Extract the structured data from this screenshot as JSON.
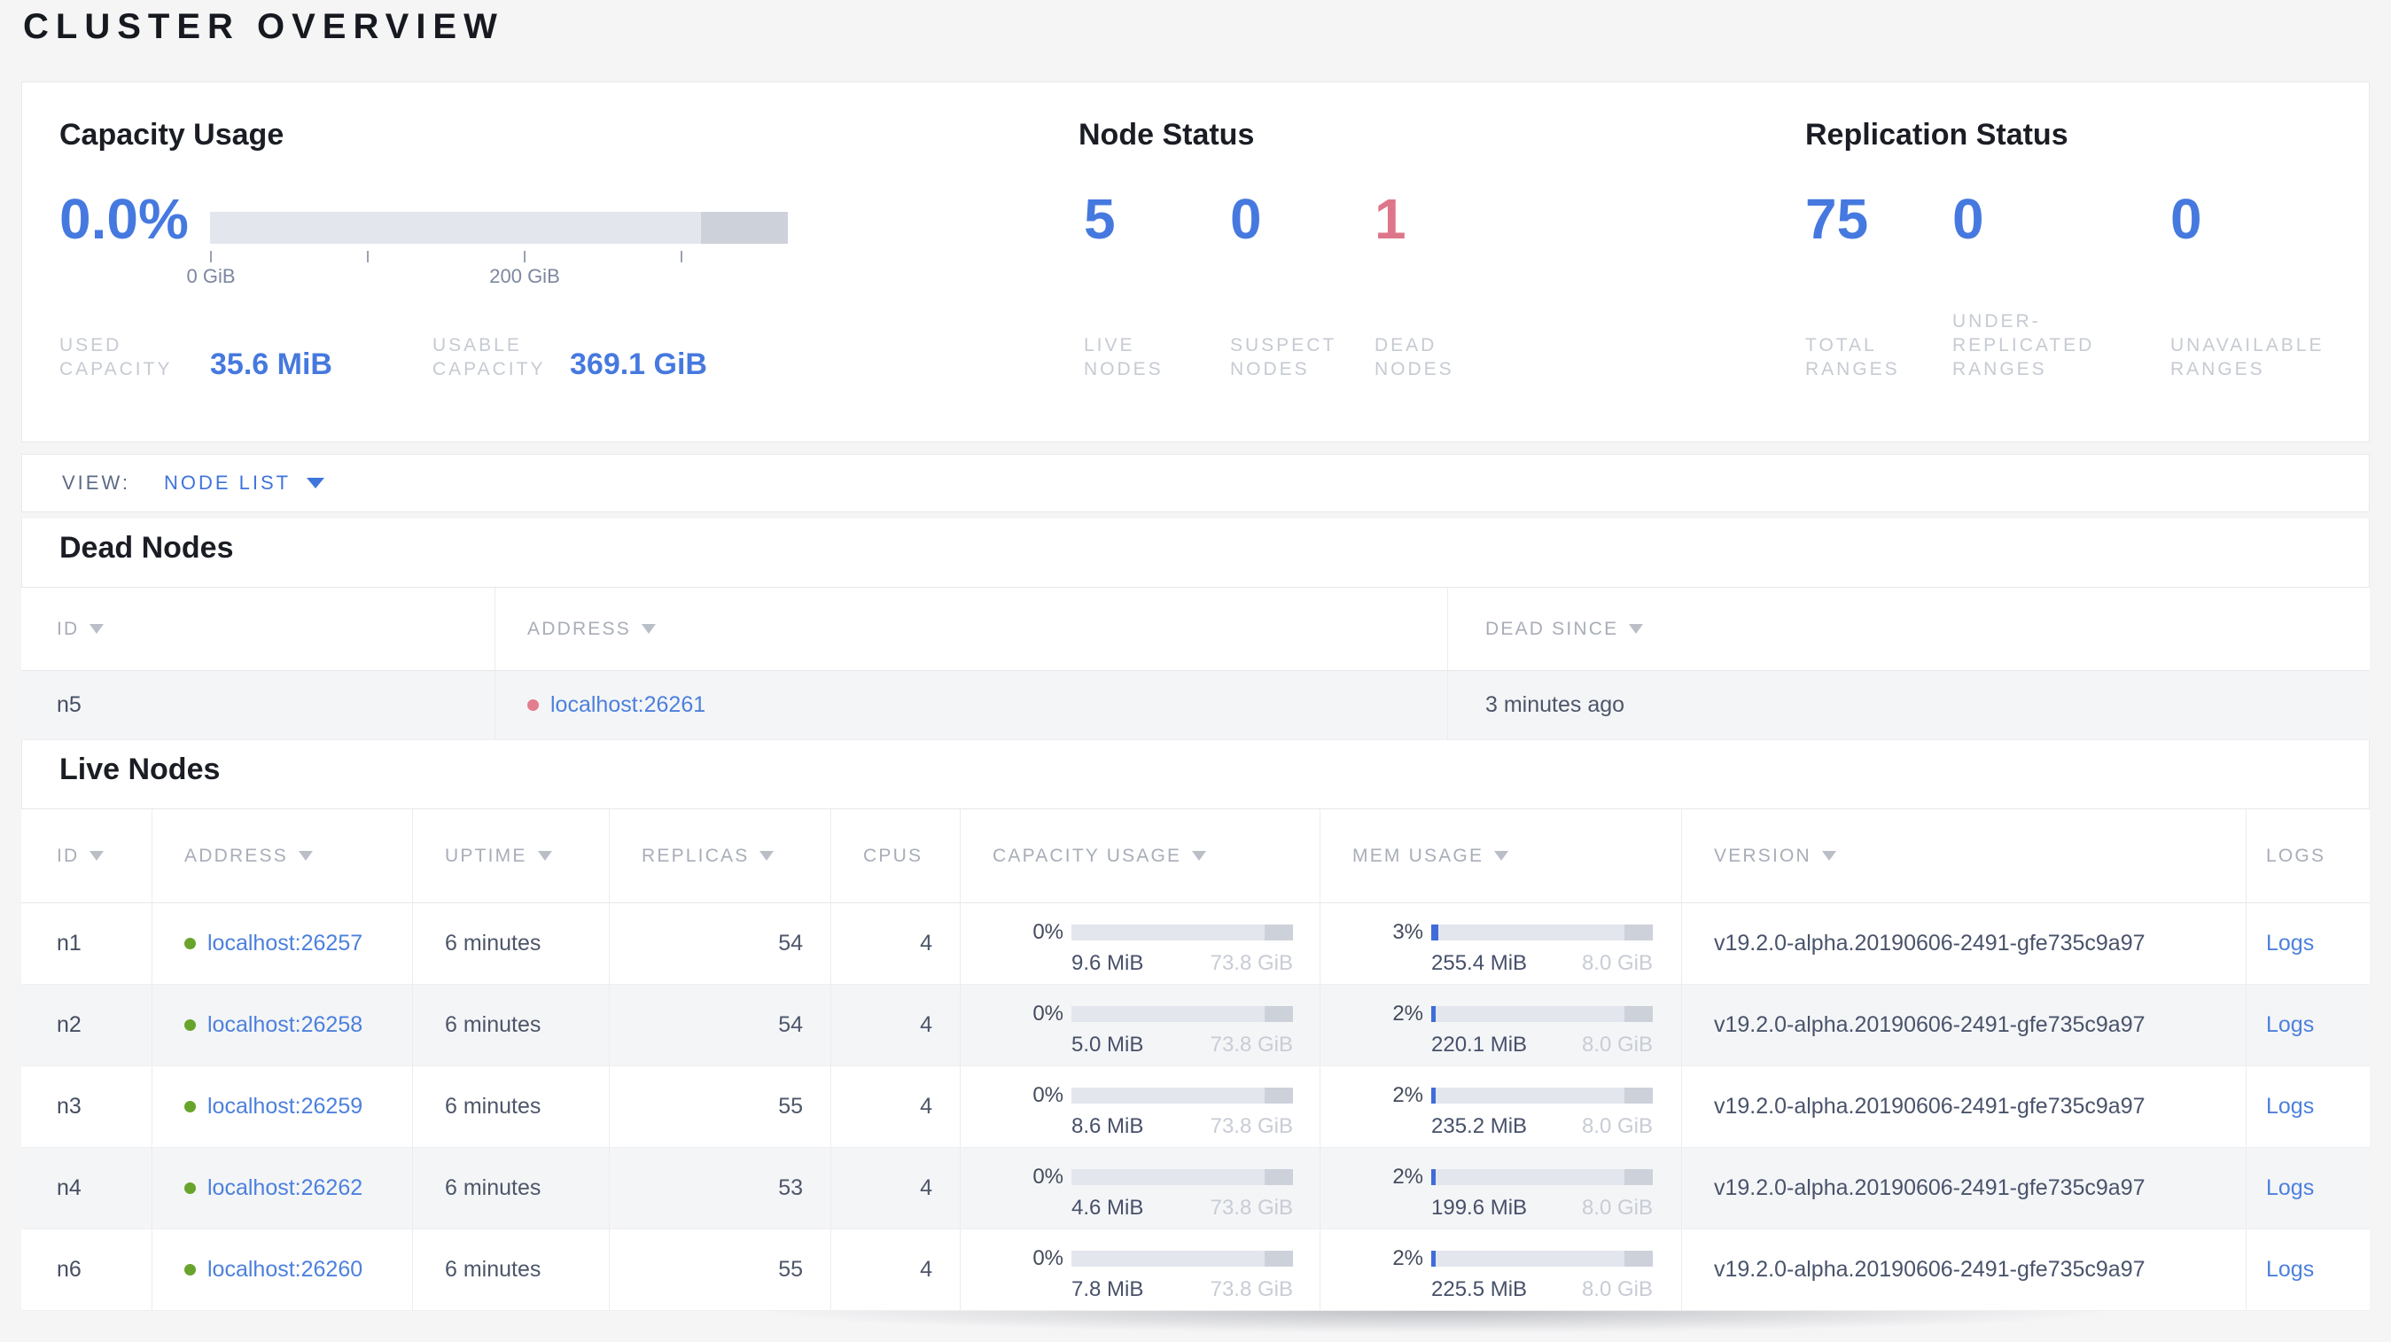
{
  "page": {
    "title": "CLUSTER OVERVIEW"
  },
  "colors": {
    "stat_blue": "#4679df",
    "link_blue": "#4c80dd",
    "dead_red": "#dd7689",
    "live_green": "#68a42c"
  },
  "capacity_panel": {
    "heading": "Capacity Usage",
    "percent": "0.0%",
    "tick_labels": [
      "0 GiB",
      "200 GiB"
    ],
    "stats": [
      {
        "lines": [
          "USED",
          "CAPACITY"
        ],
        "value": "35.6 MiB"
      },
      {
        "lines": [
          "USABLE",
          "CAPACITY"
        ],
        "value": "369.1 GiB"
      }
    ]
  },
  "node_status": {
    "heading": "Node Status",
    "stats": [
      {
        "value": "5",
        "lines": [
          "LIVE",
          "NODES"
        ]
      },
      {
        "value": "0",
        "lines": [
          "SUSPECT",
          "NODES"
        ]
      },
      {
        "value": "1",
        "lines": [
          "DEAD",
          "NODES"
        ]
      }
    ]
  },
  "replication_status": {
    "heading": "Replication Status",
    "stats": [
      {
        "value": "75",
        "lines": [
          "TOTAL",
          "RANGES"
        ]
      },
      {
        "value": "0",
        "lines": [
          "UNDER-",
          "REPLICATED",
          "RANGES"
        ]
      },
      {
        "value": "0",
        "lines": [
          "UNAVAILABLE",
          "RANGES"
        ]
      }
    ]
  },
  "view_bar": {
    "label": "VIEW:",
    "selected": "NODE LIST"
  },
  "dead_nodes": {
    "heading": "Dead Nodes",
    "columns": [
      {
        "label": "ID"
      },
      {
        "label": "ADDRESS"
      },
      {
        "label": "DEAD SINCE"
      }
    ],
    "rows": [
      {
        "id": "n5",
        "address": "localhost:26261",
        "dead_since": "3 minutes ago"
      }
    ]
  },
  "live_nodes": {
    "heading": "Live Nodes",
    "columns": [
      {
        "label": "ID"
      },
      {
        "label": "ADDRESS"
      },
      {
        "label": "UPTIME"
      },
      {
        "label": "REPLICAS"
      },
      {
        "label": "CPUS"
      },
      {
        "label": "CAPACITY USAGE"
      },
      {
        "label": "MEM USAGE"
      },
      {
        "label": "VERSION"
      },
      {
        "label": "LOGS"
      }
    ],
    "rows": [
      {
        "id": "n1",
        "address": "localhost:26257",
        "uptime": "6 minutes",
        "replicas": "54",
        "cpus": "4",
        "capacity": {
          "percent": "0%",
          "used": "9.6 MiB",
          "total": "73.8 GiB"
        },
        "memory": {
          "percent": "3%",
          "used": "255.4 MiB",
          "total": "8.0 GiB"
        },
        "version": "v19.2.0-alpha.20190606-2491-gfe735c9a97",
        "logs": "Logs"
      },
      {
        "id": "n2",
        "address": "localhost:26258",
        "uptime": "6 minutes",
        "replicas": "54",
        "cpus": "4",
        "capacity": {
          "percent": "0%",
          "used": "5.0 MiB",
          "total": "73.8 GiB"
        },
        "memory": {
          "percent": "2%",
          "used": "220.1 MiB",
          "total": "8.0 GiB"
        },
        "version": "v19.2.0-alpha.20190606-2491-gfe735c9a97",
        "logs": "Logs"
      },
      {
        "id": "n3",
        "address": "localhost:26259",
        "uptime": "6 minutes",
        "replicas": "55",
        "cpus": "4",
        "capacity": {
          "percent": "0%",
          "used": "8.6 MiB",
          "total": "73.8 GiB"
        },
        "memory": {
          "percent": "2%",
          "used": "235.2 MiB",
          "total": "8.0 GiB"
        },
        "version": "v19.2.0-alpha.20190606-2491-gfe735c9a97",
        "logs": "Logs"
      },
      {
        "id": "n4",
        "address": "localhost:26262",
        "uptime": "6 minutes",
        "replicas": "53",
        "cpus": "4",
        "capacity": {
          "percent": "0%",
          "used": "4.6 MiB",
          "total": "73.8 GiB"
        },
        "memory": {
          "percent": "2%",
          "used": "199.6 MiB",
          "total": "8.0 GiB"
        },
        "version": "v19.2.0-alpha.20190606-2491-gfe735c9a97",
        "logs": "Logs"
      },
      {
        "id": "n6",
        "address": "localhost:26260",
        "uptime": "6 minutes",
        "replicas": "55",
        "cpus": "4",
        "capacity": {
          "percent": "0%",
          "used": "7.8 MiB",
          "total": "73.8 GiB"
        },
        "memory": {
          "percent": "2%",
          "used": "225.5 MiB",
          "total": "8.0 GiB"
        },
        "version": "v19.2.0-alpha.20190606-2491-gfe735c9a97",
        "logs": "Logs"
      }
    ]
  }
}
